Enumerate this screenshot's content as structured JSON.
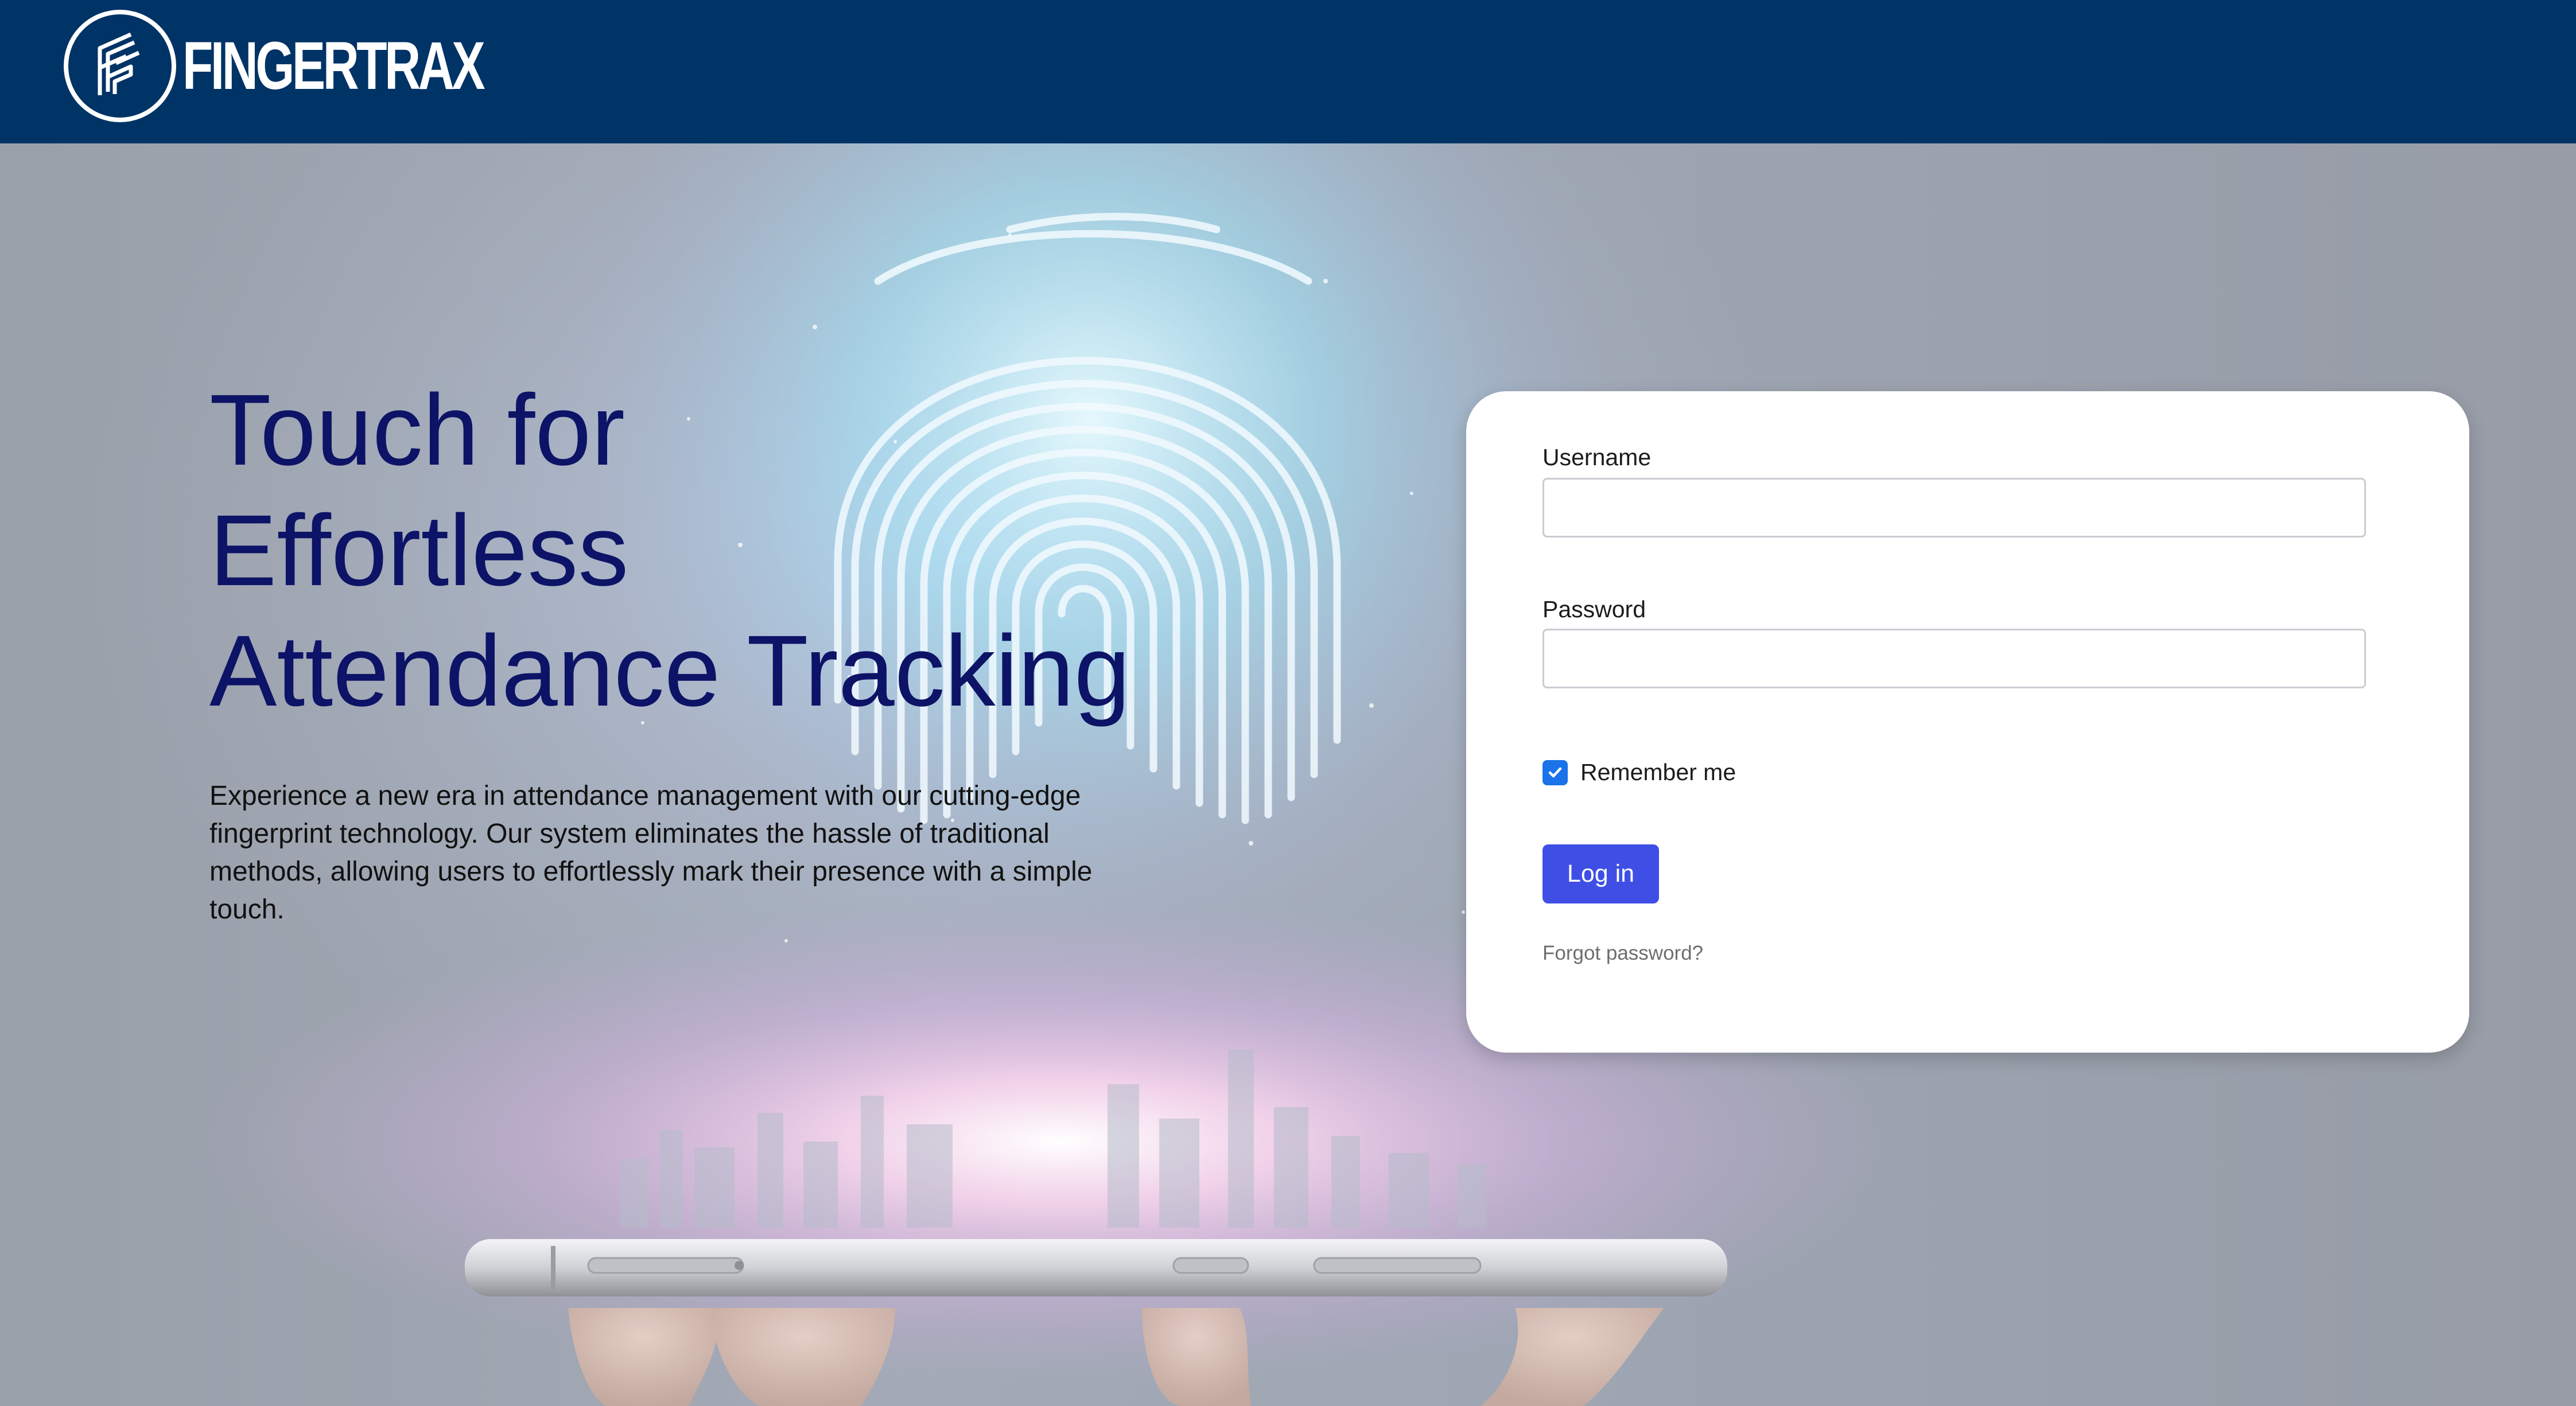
{
  "brand": {
    "name": "FINGERTRAX",
    "logo_icon": "fingertrax-logo-icon"
  },
  "colors": {
    "nav_background": "#003366",
    "headline": "#0d1366",
    "login_button": "#3f4fe5",
    "checkbox": "#1a73e8"
  },
  "hero": {
    "headline_lines": [
      "Touch for",
      "Effortless",
      "Attendance Tracking"
    ],
    "description": "Experience a new era in attendance management with our cutting-edge fingerprint technology. Our system eliminates the hassle of traditional methods, allowing users to effortlessly mark their presence with a simple touch.",
    "background_image": "fingerprint-hologram-over-smartphone"
  },
  "login": {
    "username_label": "Username",
    "username_value": "",
    "password_label": "Password",
    "password_value": "",
    "remember_label": "Remember me",
    "remember_checked": true,
    "submit_label": "Log in",
    "forgot_label": "Forgot password?"
  }
}
